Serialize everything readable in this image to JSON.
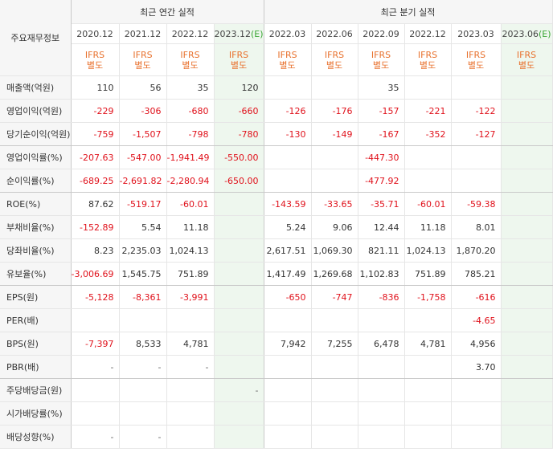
{
  "corner_label": "주요재무정보",
  "group_headers": {
    "annual": "최근 연간 실적",
    "quarterly": "최근 분기 실적"
  },
  "periods": [
    {
      "date": "2020.12",
      "est": "",
      "std1": "IFRS",
      "std2": "별도"
    },
    {
      "date": "2021.12",
      "est": "",
      "std1": "IFRS",
      "std2": "별도"
    },
    {
      "date": "2022.12",
      "est": "",
      "std1": "IFRS",
      "std2": "별도"
    },
    {
      "date": "2023.12",
      "est": "(E)",
      "std1": "IFRS",
      "std2": "별도"
    },
    {
      "date": "2022.03",
      "est": "",
      "std1": "IFRS",
      "std2": "별도"
    },
    {
      "date": "2022.06",
      "est": "",
      "std1": "IFRS",
      "std2": "별도"
    },
    {
      "date": "2022.09",
      "est": "",
      "std1": "IFRS",
      "std2": "별도"
    },
    {
      "date": "2022.12",
      "est": "",
      "std1": "IFRS",
      "std2": "별도"
    },
    {
      "date": "2023.03",
      "est": "",
      "std1": "IFRS",
      "std2": "별도"
    },
    {
      "date": "2023.06",
      "est": "(E)",
      "std1": "IFRS",
      "std2": "별도"
    }
  ],
  "rows": [
    {
      "label": "매출액(억원)",
      "values": [
        "110",
        "56",
        "35",
        "120",
        "",
        "",
        "35",
        "",
        "",
        ""
      ]
    },
    {
      "label": "영업이익(억원)",
      "values": [
        "-229",
        "-306",
        "-680",
        "-660",
        "-126",
        "-176",
        "-157",
        "-221",
        "-122",
        ""
      ]
    },
    {
      "label": "당기순이익(억원)",
      "values": [
        "-759",
        "-1,507",
        "-798",
        "-780",
        "-130",
        "-149",
        "-167",
        "-352",
        "-127",
        ""
      ]
    },
    {
      "label": "영업이익률(%)",
      "values": [
        "-207.63",
        "-547.00",
        "-1,941.49",
        "-550.00",
        "",
        "",
        "-447.30",
        "",
        "",
        ""
      ]
    },
    {
      "label": "순이익률(%)",
      "values": [
        "-689.25",
        "-2,691.82",
        "-2,280.94",
        "-650.00",
        "",
        "",
        "-477.92",
        "",
        "",
        ""
      ]
    },
    {
      "label": "ROE(%)",
      "values": [
        "87.62",
        "-519.17",
        "-60.01",
        "",
        "-143.59",
        "-33.65",
        "-35.71",
        "-60.01",
        "-59.38",
        ""
      ]
    },
    {
      "label": "부채비율(%)",
      "values": [
        "-152.89",
        "5.54",
        "11.18",
        "",
        "5.24",
        "9.06",
        "12.44",
        "11.18",
        "8.01",
        ""
      ]
    },
    {
      "label": "당좌비율(%)",
      "values": [
        "8.23",
        "2,235.03",
        "1,024.13",
        "",
        "2,617.51",
        "1,069.30",
        "821.11",
        "1,024.13",
        "1,870.20",
        ""
      ]
    },
    {
      "label": "유보율(%)",
      "values": [
        "-3,006.69",
        "1,545.75",
        "751.89",
        "",
        "1,417.49",
        "1,269.68",
        "1,102.83",
        "751.89",
        "785.21",
        ""
      ]
    },
    {
      "label": "EPS(원)",
      "values": [
        "-5,128",
        "-8,361",
        "-3,991",
        "",
        "-650",
        "-747",
        "-836",
        "-1,758",
        "-616",
        ""
      ]
    },
    {
      "label": "PER(배)",
      "values": [
        "",
        "",
        "",
        "",
        "",
        "",
        "",
        "",
        "-4.65",
        ""
      ]
    },
    {
      "label": "BPS(원)",
      "values": [
        "-7,397",
        "8,533",
        "4,781",
        "",
        "7,942",
        "7,255",
        "6,478",
        "4,781",
        "4,956",
        ""
      ]
    },
    {
      "label": "PBR(배)",
      "values": [
        "-",
        "-",
        "-",
        "",
        "",
        "",
        "",
        "",
        "3.70",
        ""
      ]
    },
    {
      "label": "주당배당금(원)",
      "values": [
        "",
        "",
        "",
        "-",
        "",
        "",
        "",
        "",
        "",
        ""
      ]
    },
    {
      "label": "시가배당률(%)",
      "values": [
        "",
        "",
        "",
        "",
        "",
        "",
        "",
        "",
        "",
        ""
      ]
    },
    {
      "label": "배당성향(%)",
      "values": [
        "-",
        "-",
        "",
        "",
        "",
        "",
        "",
        "",
        "",
        ""
      ]
    }
  ],
  "group_end_rows": [
    2,
    4,
    8,
    12
  ],
  "colors": {
    "negative": "#e0111b",
    "standard": "#e8722f",
    "estimate_bg": "#eef7ee"
  }
}
